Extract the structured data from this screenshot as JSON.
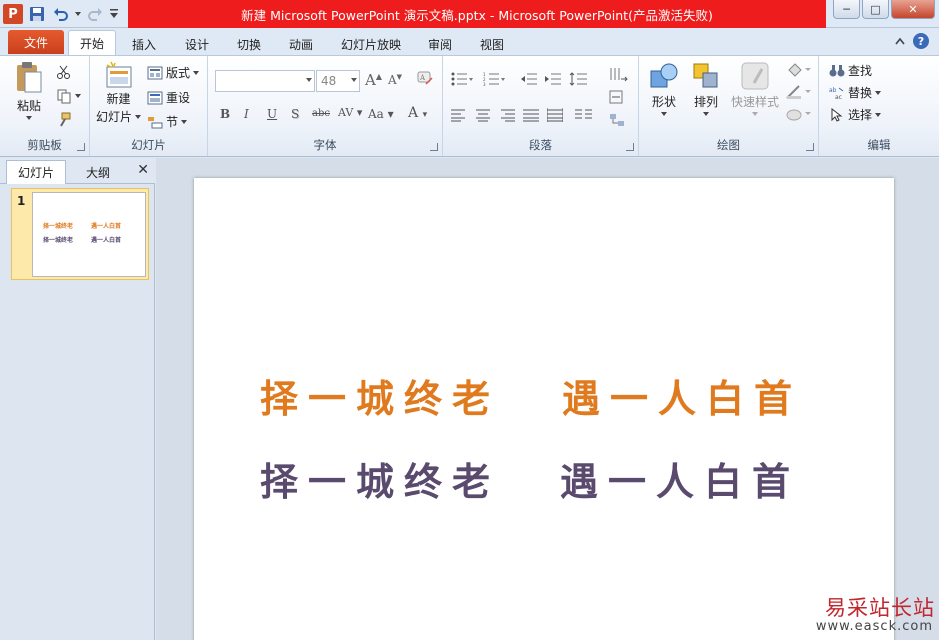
{
  "window": {
    "title": "新建 Microsoft PowerPoint 演示文稿.pptx - Microsoft PowerPoint(产品激活失败)",
    "minimize": "─",
    "maximize": "□",
    "close": "✕"
  },
  "qat": {
    "app_letter": "P"
  },
  "tabs": {
    "file": "文件",
    "items": [
      "开始",
      "插入",
      "设计",
      "切换",
      "动画",
      "幻灯片放映",
      "审阅",
      "视图"
    ],
    "help": "?"
  },
  "ribbon": {
    "clipboard": {
      "paste": "粘贴",
      "label": "剪贴板"
    },
    "slides": {
      "new_slide_line1": "新建",
      "new_slide_line2": "幻灯片",
      "layout": "版式",
      "reset": "重设",
      "section": "节",
      "label": "幻灯片"
    },
    "font": {
      "font_name": "",
      "font_size": "48",
      "bold": "B",
      "italic": "I",
      "underline": "U",
      "shadow": "S",
      "strike": "abc",
      "spacing": "AV",
      "case": "Aa",
      "color": "A",
      "grow": "A",
      "shrink": "A",
      "label": "字体"
    },
    "paragraph": {
      "label": "段落"
    },
    "drawing": {
      "shapes": "形状",
      "arrange": "排列",
      "quick_styles": "快速样式",
      "label": "绘图"
    },
    "editing": {
      "find": "查找",
      "replace": "替换",
      "select": "选择",
      "label": "编辑"
    }
  },
  "left_pane": {
    "tab_slides": "幻灯片",
    "tab_outline": "大纲",
    "close": "✕",
    "slide_number": "1",
    "thumb_lines": [
      "择一城终老",
      "遇一人白首",
      "择一城终老",
      "遇一人白首"
    ]
  },
  "slide": {
    "line1_left": "择一城终老",
    "line1_right": "遇一人白首",
    "line2_left": "择一城终老",
    "line2_right": "遇一人白首"
  },
  "watermark": {
    "main": "易采站长站",
    "url": "www.easck.com"
  },
  "colors": {
    "orange": "#e07a1e",
    "purple": "#5a4a6e",
    "title_red": "#ee1c1c",
    "file_tab": "#d9502a"
  }
}
